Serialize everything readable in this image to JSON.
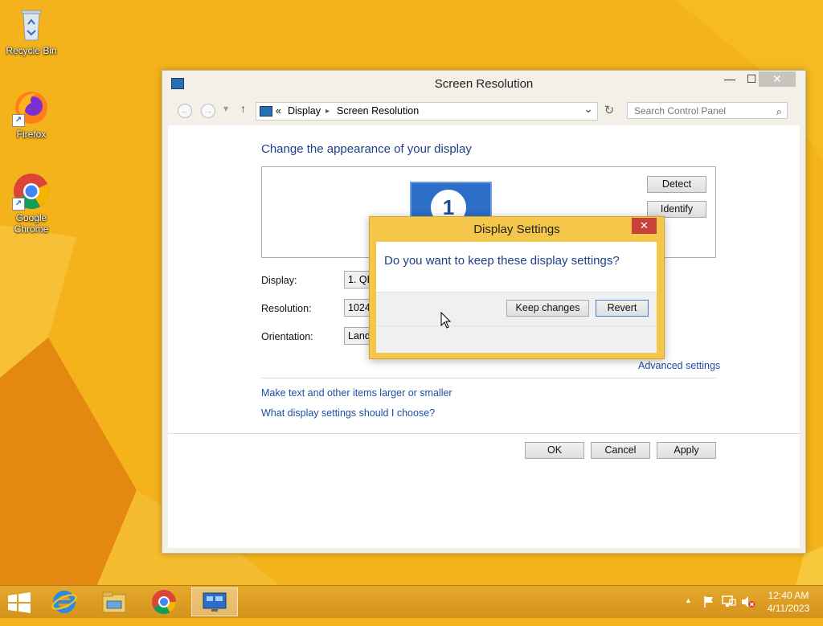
{
  "desktop": {
    "icons": [
      {
        "label": "Recycle Bin"
      },
      {
        "label": "Firefox"
      },
      {
        "label": "Google Chrome"
      }
    ]
  },
  "window": {
    "title": "Screen Resolution",
    "controls": {
      "minimize": "—",
      "maximize": "☐",
      "close": "✕"
    },
    "nav": {
      "back": "←",
      "forward": "→",
      "recent": "▾",
      "up": "↑",
      "breadcrumb_prefix": "«",
      "breadcrumb": [
        "Display",
        "Screen Resolution"
      ],
      "separator": "▸",
      "dropdown": "⌄",
      "refresh": "↻"
    },
    "search": {
      "placeholder": "Search Control Panel",
      "icon": "⌕"
    },
    "heading": "Change the appearance of your display",
    "monitor_number": "1",
    "buttons": {
      "detect": "Detect",
      "identify": "Identify",
      "ok": "OK",
      "cancel": "Cancel",
      "apply": "Apply"
    },
    "fields": {
      "display_label": "Display:",
      "display_value": "1. QE",
      "resolution_label": "Resolution:",
      "resolution_value": "1024",
      "orientation_label": "Orientation:",
      "orientation_value": "Land"
    },
    "links": {
      "advanced": "Advanced settings",
      "text_size": "Make text and other items larger or smaller",
      "which_settings": "What display settings should I choose?"
    }
  },
  "dialog": {
    "title": "Display Settings",
    "close": "✕",
    "question": "Do you want to keep these display settings?",
    "keep_label": "Keep changes",
    "revert_label": "Revert"
  },
  "taskbar": {
    "clock_time": "12:40 AM",
    "clock_date": "4/11/2023",
    "tray_chevron": "▲"
  },
  "colors": {
    "desktop": "#f4b31a",
    "dialog_frame": "#f4c74a",
    "link": "#1c4fa3",
    "close_red": "#c8413b"
  }
}
